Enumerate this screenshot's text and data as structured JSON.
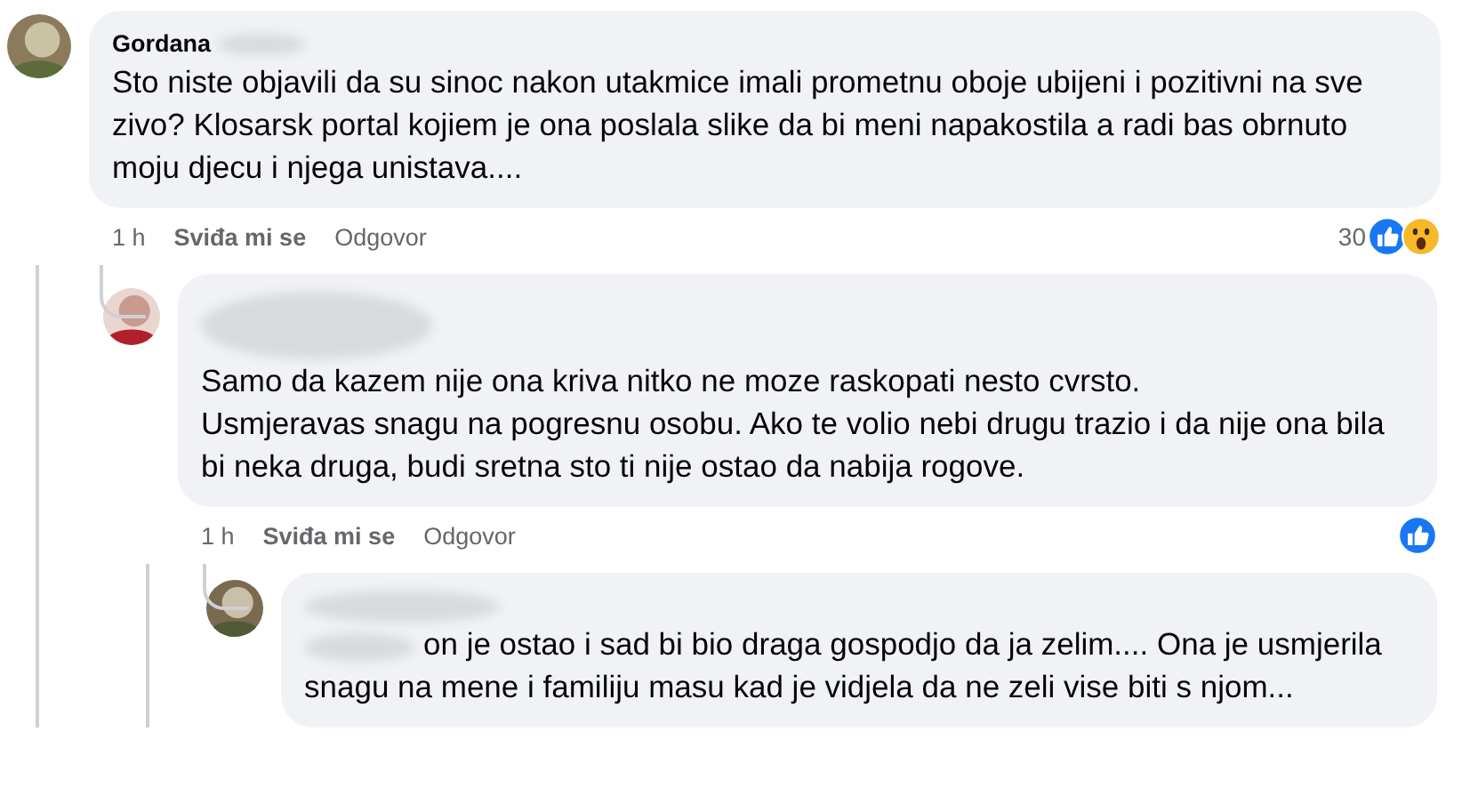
{
  "comments": [
    {
      "author": "Gordana",
      "author_blurred": true,
      "body": "Sto niste objavili da su sinoc nakon utakmice imali prometnu oboje ubijeni i pozitivni na sve zivo? Klosarsk portal kojiem je ona poslala slike da bi meni napakostila a radi bas obrnuto moju djecu i njega unistava....",
      "time": "1 h",
      "like_label": "Sviđa mi se",
      "reply_label": "Odgovor",
      "reaction_count": "30",
      "reactions": [
        {
          "kind": "like"
        },
        {
          "kind": "wow"
        }
      ],
      "children": [
        {
          "author_blurred": true,
          "body": "Samo da kazem nije ona kriva nitko ne moze raskopati nesto cvrsto.\nUsmjeravas snagu na pogresnu osobu. Ako te volio nebi drugu trazio i da nije ona bila bi neka druga, budi sretna sto ti nije ostao da nabija rogove.",
          "time": "1 h",
          "like_label": "Sviđa mi se",
          "reply_label": "Odgovor",
          "reactions": [
            {
              "kind": "like"
            }
          ],
          "children": [
            {
              "author_blurred": true,
              "mention_blurred": true,
              "body": "on je ostao i sad bi bio draga gospodjo da ja zelim.... Ona je usmjerila snagu na mene i familiju masu kad je vidjela da ne zeli vise biti s njom..."
            }
          ]
        }
      ]
    }
  ]
}
